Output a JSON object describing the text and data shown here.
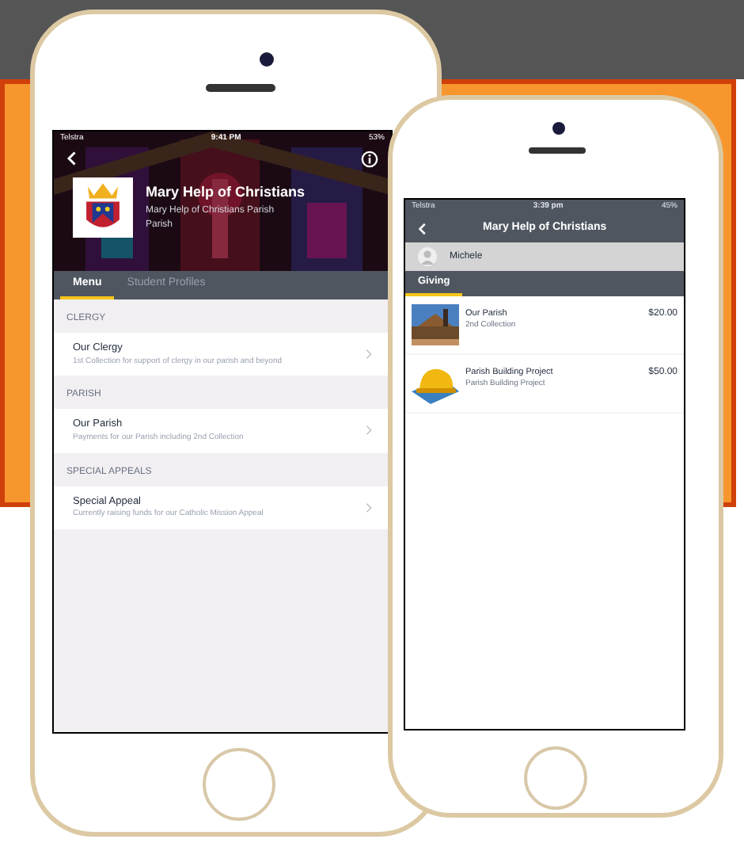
{
  "phone_left": {
    "status_bar": {
      "carrier": "Telstra",
      "time": "9:41 PM",
      "battery": "53%"
    },
    "header": {
      "title": "Mary Help of Christians",
      "subtitle": "Mary Help of Christians Parish",
      "subtitle_2": "Parish"
    },
    "tabs": [
      {
        "label": "Menu",
        "selected": true
      },
      {
        "label": "Student Profiles",
        "selected": false
      }
    ],
    "sections": [
      {
        "heading": "CLERGY",
        "items": [
          {
            "title": "Our Clergy",
            "description": "1st Collection for support of clergy in our parish and beyond"
          }
        ]
      },
      {
        "heading": "PARISH",
        "items": [
          {
            "title": "Our Parish",
            "description": "Payments for our Parish including 2nd Collection"
          }
        ]
      },
      {
        "heading": "SPECIAL APPEALS",
        "items": [
          {
            "title": "Special Appeal",
            "description": "Currently raising funds for our Catholic Mission Appeal"
          }
        ]
      }
    ]
  },
  "phone_right": {
    "status_bar": {
      "carrier": "Telstra",
      "time": "3:39 pm",
      "battery": "45%"
    },
    "title": "Mary Help of Christians",
    "user": "Michele",
    "tabs": [
      {
        "label": "Giving",
        "selected": true
      }
    ],
    "items": [
      {
        "kind": "church",
        "title": "Our Parish",
        "subtitle": "2nd Collection",
        "amount": "$20.00"
      },
      {
        "kind": "hardhat",
        "title": "Parish Building Project",
        "subtitle": "Parish Building Project",
        "amount": "$50.00"
      }
    ]
  }
}
